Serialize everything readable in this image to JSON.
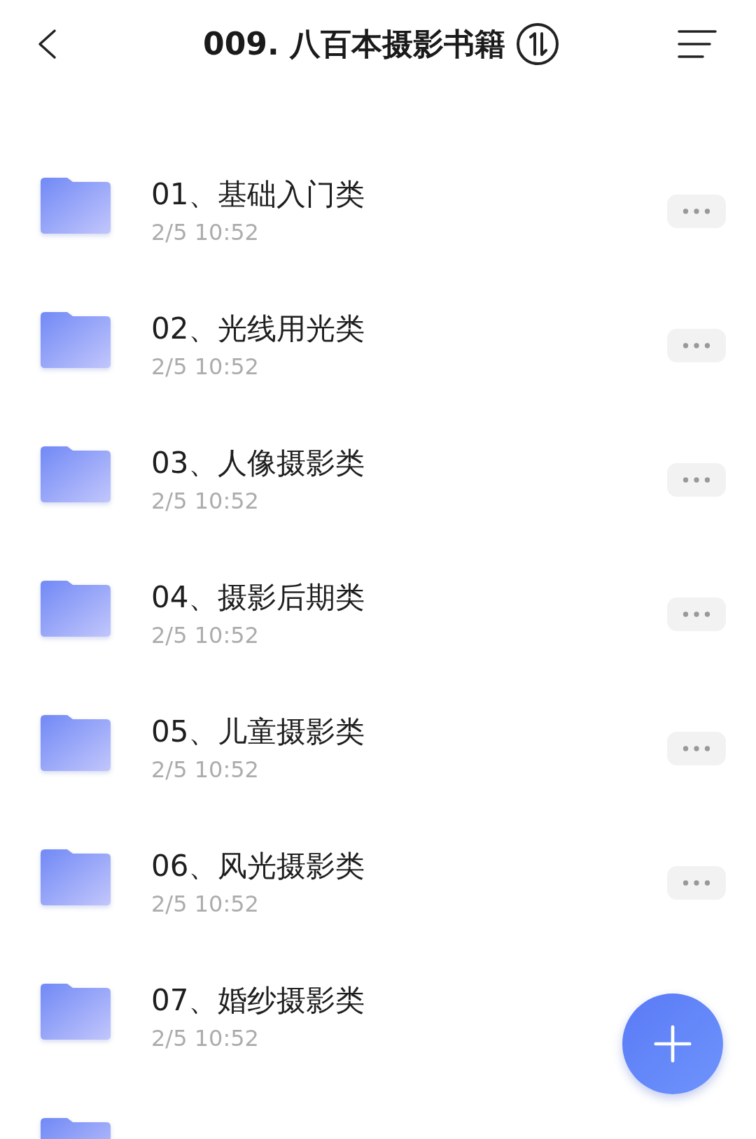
{
  "header": {
    "title": "009. 八百本摄影书籍"
  },
  "folders": [
    {
      "name": "01、基础入门类",
      "date": "2/5 10:52",
      "more": true
    },
    {
      "name": "02、光线用光类",
      "date": "2/5 10:52",
      "more": true
    },
    {
      "name": "03、人像摄影类",
      "date": "2/5 10:52",
      "more": true
    },
    {
      "name": "04、摄影后期类",
      "date": "2/5 10:52",
      "more": true
    },
    {
      "name": "05、儿童摄影类",
      "date": "2/5 10:52",
      "more": true
    },
    {
      "name": "06、风光摄影类",
      "date": "2/5 10:52",
      "more": true
    },
    {
      "name": "07、婚纱摄影类",
      "date": "2/5 10:52",
      "more": false
    },
    {
      "more": false
    }
  ]
}
